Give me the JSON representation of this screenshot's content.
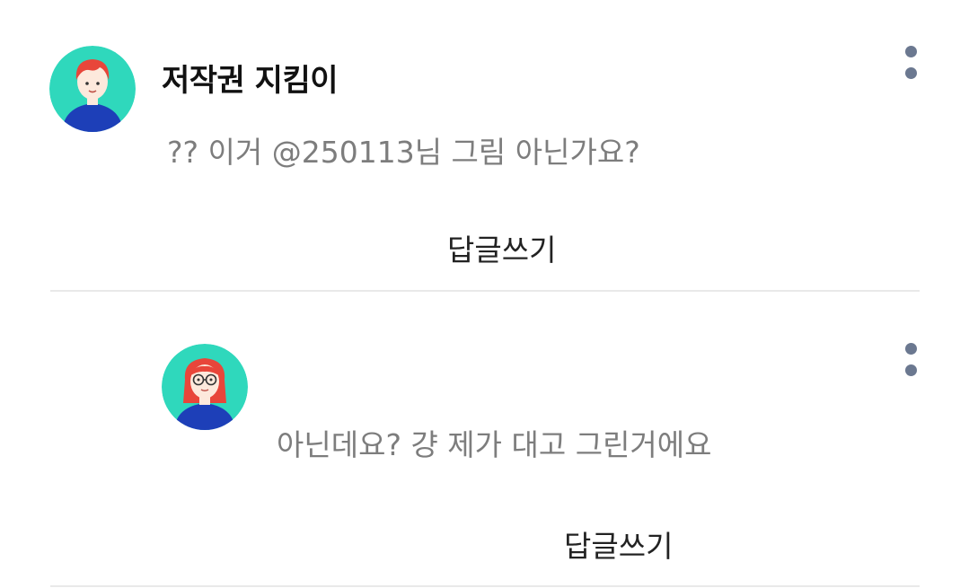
{
  "comments": [
    {
      "author": "저작권 지킴이",
      "text": "?? 이거 @250113님 그림 아닌가요?",
      "reply_label": "답글쓰기",
      "avatar": "avatar-boy-red-hair-icon",
      "more_icon": "more-vertical-icon"
    },
    {
      "author": "",
      "text": "아닌데요? 걍 제가 대고 그린거에요",
      "reply_label": "답글쓰기",
      "avatar": "avatar-girl-glasses-icon",
      "more_icon": "more-vertical-icon"
    }
  ],
  "colors": {
    "avatar_bg": "#2fd8bc",
    "hair": "#e8463a",
    "shirt": "#1d3fb8",
    "skin": "#fde9dc",
    "more_dots": "#6b7890",
    "comment_text": "#7d7d7d",
    "divider": "#e9e9e9"
  }
}
